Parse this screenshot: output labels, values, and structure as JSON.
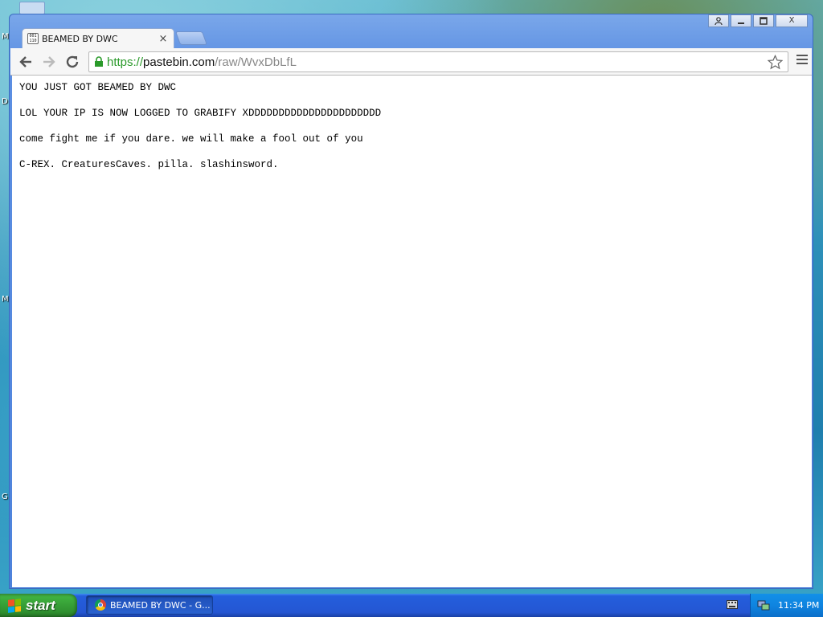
{
  "desktop": {
    "edge_letters": [
      "M",
      "D",
      "M",
      "G"
    ]
  },
  "window": {
    "controls": {
      "user_icon": "user-icon",
      "minimize_icon": "minimize-icon",
      "maximize_icon": "restore-icon",
      "close_label": "X"
    }
  },
  "tab": {
    "title": "BEAMED BY DWC",
    "favicon_text": "001 110 101",
    "close_label": "×"
  },
  "toolbar": {
    "url_scheme": "https://",
    "url_host": "pastebin.com",
    "url_path": "/raw/WvxDbLfL"
  },
  "content": {
    "lines": [
      "YOU JUST GOT BEAMED BY DWC",
      "LOL YOUR IP IS NOW LOGGED TO GRABIFY XDDDDDDDDDDDDDDDDDDDDDD",
      "come fight me if you dare. we will make a fool out of you",
      "C-REX. CreaturesCaves. pilla. slashinsword."
    ]
  },
  "taskbar": {
    "start_label": "start",
    "task_label": "BEAMED BY DWC - G...",
    "clock": "11:34 PM"
  },
  "colors": {
    "url_scheme": "#2a9a2a",
    "start_green": "#3fb13f",
    "taskbar_blue": "#2456d3"
  }
}
